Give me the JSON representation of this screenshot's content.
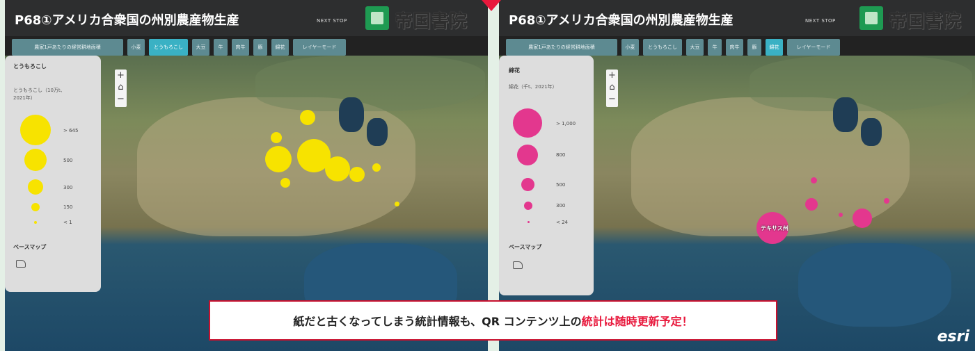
{
  "left": {
    "title": "P68①アメリカ合衆国の州別農産物生産",
    "next_stop": "NEXT STOP",
    "brand": "帝国書院",
    "tabs": [
      "農家1戸あたりの経営耕地面積",
      "小麦",
      "とうもろこし",
      "大豆",
      "牛",
      "肉牛",
      "豚",
      "綿花",
      "レイヤーモード"
    ],
    "active_tab": "とうもろこし",
    "legend": {
      "title": "とうもろこし",
      "subtitle": "とうもろこし（10万t、2021年）",
      "items": [
        "> 645",
        "500",
        "300",
        "150",
        "< 1"
      ],
      "basemap": "ベースマップ"
    },
    "symbol_color": "#f7e300"
  },
  "right": {
    "title": "P68①アメリカ合衆国の州別農産物生産",
    "next_stop": "NEXT STOP",
    "brand": "帝国書院",
    "tabs": [
      "農家1戸あたりの経営耕地面積",
      "小麦",
      "とうもろこし",
      "大豆",
      "牛",
      "肉牛",
      "豚",
      "綿花",
      "レイヤーモード"
    ],
    "active_tab": "綿花",
    "legend": {
      "title": "綿花",
      "subtitle": "綿花（千t、2021年）",
      "items": [
        "> 1,000",
        "800",
        "500",
        "300",
        "< 24"
      ],
      "basemap": "ベースマップ"
    },
    "symbol_color": "#e3378e",
    "state_label": "テキサス州",
    "esri": "esri"
  },
  "map_controls": {
    "zoom_in": "+",
    "home": "⌂",
    "zoom_out": "−"
  },
  "banner": {
    "text_before": "紙だと古くなってしまう統計情報も、QR コンテンツ上の",
    "text_highlight": "統計は随時更新予定",
    "text_after": "！"
  }
}
